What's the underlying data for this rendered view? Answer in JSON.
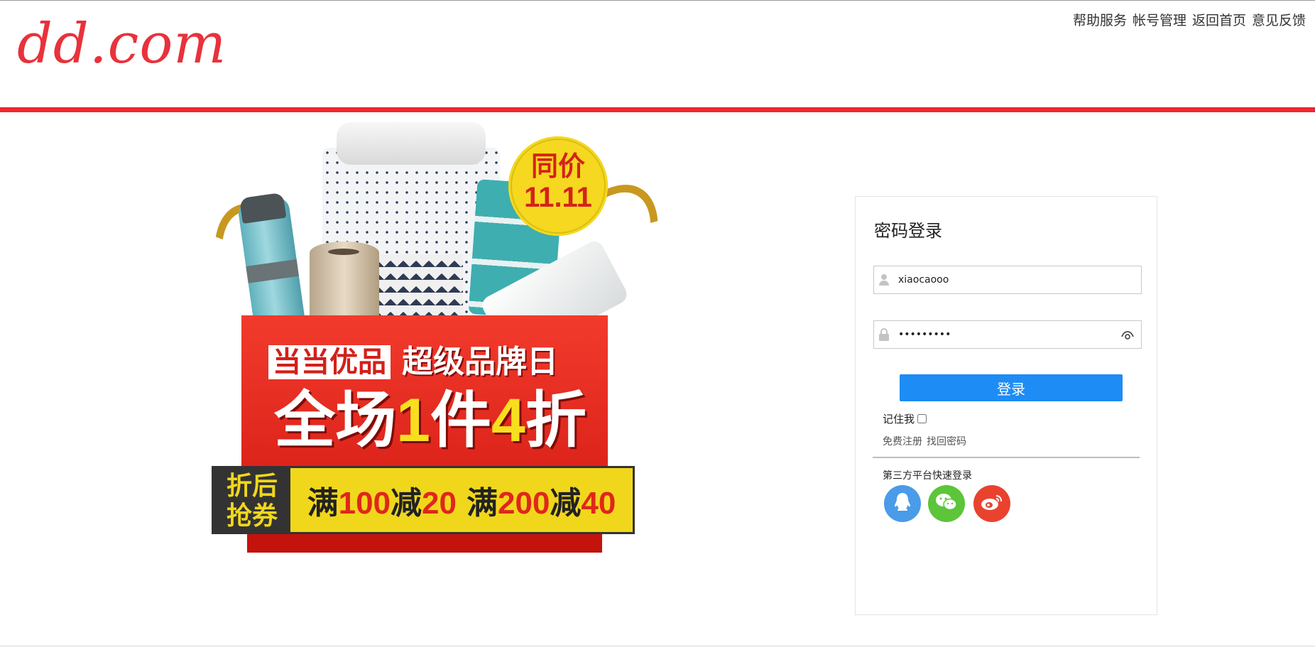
{
  "header": {
    "logo": "dd.com",
    "links": [
      "帮助服务",
      "帐号管理",
      "返回首页",
      "意见反馈"
    ]
  },
  "promo": {
    "badge_line1": "同价",
    "badge_line2": "11.11",
    "brand_tag": "当当优品",
    "brand_day": "超级品牌日",
    "sale_prefix": "全场",
    "sale_num1": "1",
    "sale_mid": "件",
    "sale_num2": "4",
    "sale_suffix": "折",
    "coupon_label_line1": "折后",
    "coupon_label_line2": "抢券",
    "offer1_a": "满",
    "offer1_b": "100",
    "offer1_c": "减",
    "offer1_d": "20",
    "offer2_a": "满",
    "offer2_b": "200",
    "offer2_c": "减",
    "offer2_d": "40"
  },
  "login": {
    "title": "密码登录",
    "username_value": "xiaocaooo",
    "password_value": "123456789",
    "submit_label": "登录",
    "remember_label": "记住我",
    "register_label": "免费注册",
    "forgot_label": "找回密码",
    "third_party_title": "第三方平台快速登录"
  },
  "colors": {
    "brand_red": "#f0262f",
    "button_blue": "#1e8cf5",
    "qq": "#4a9be8",
    "wechat": "#5cc53a",
    "weibo": "#e9432f"
  },
  "icons": [
    "user-icon",
    "lock-icon",
    "eye-icon",
    "qq-icon",
    "wechat-icon",
    "weibo-icon"
  ]
}
